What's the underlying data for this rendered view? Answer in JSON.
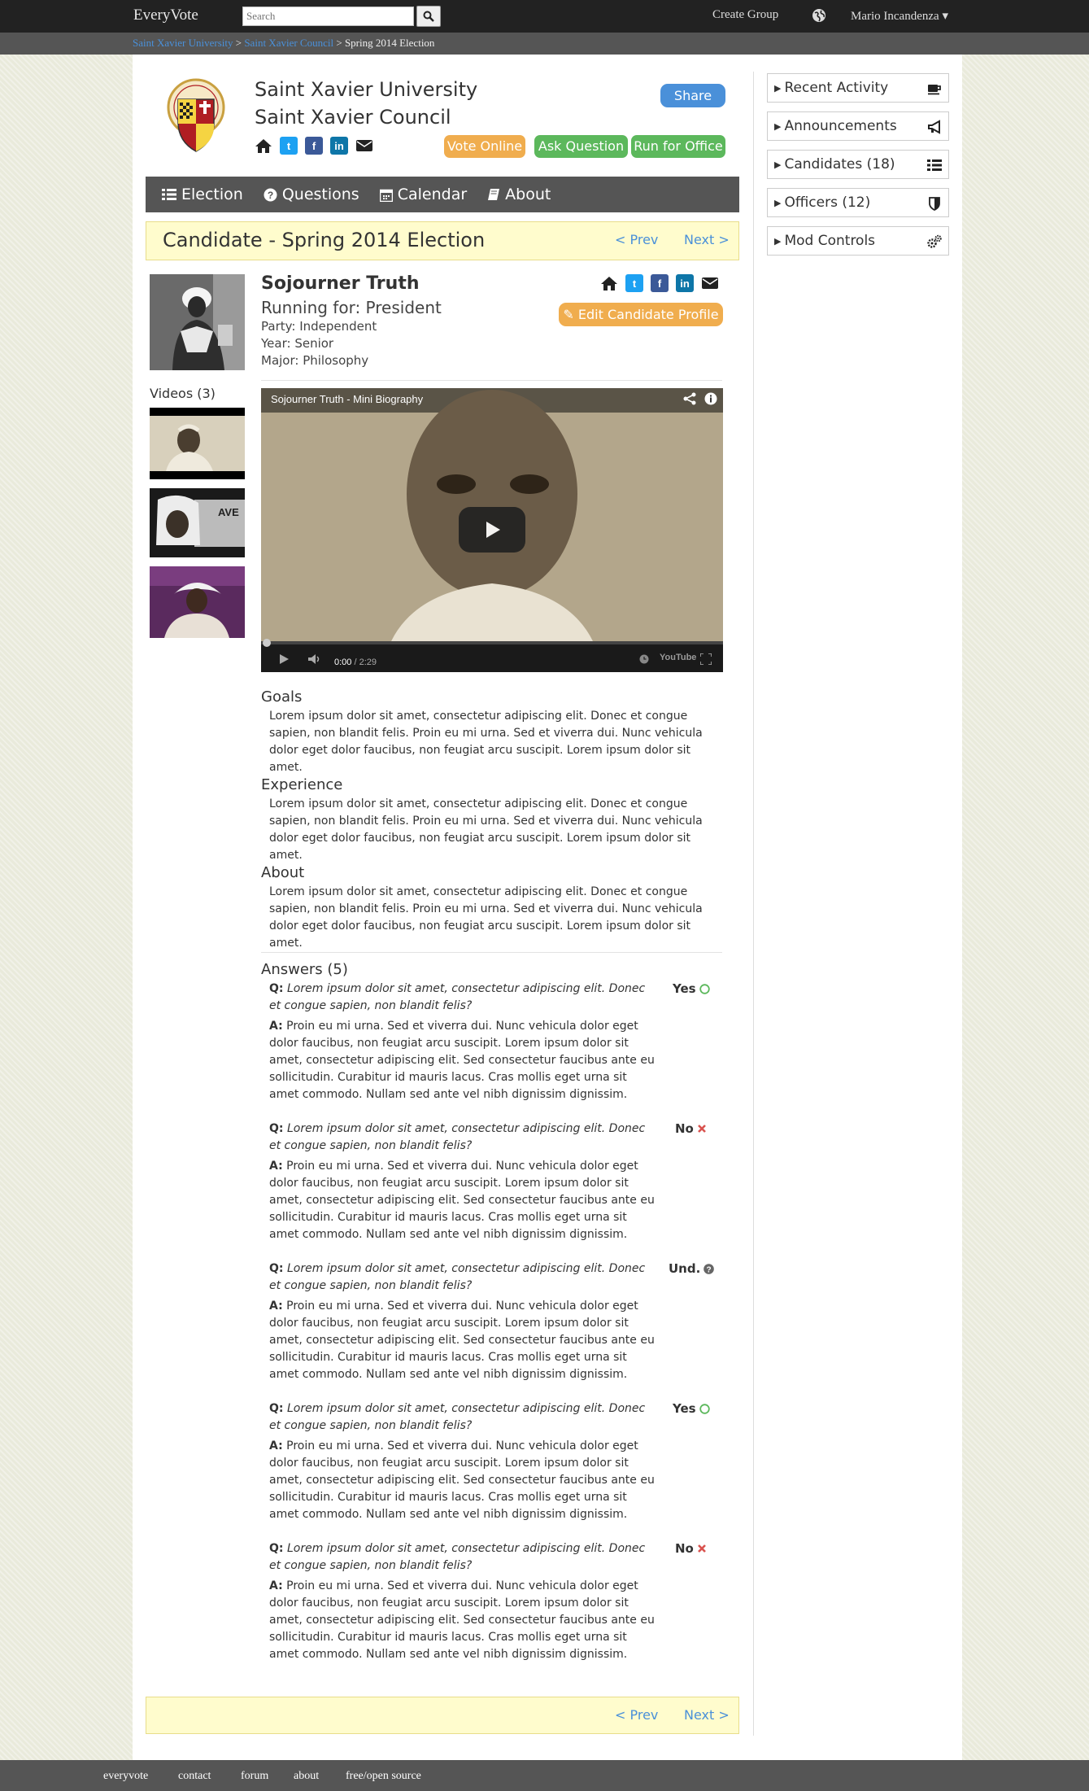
{
  "topbar": {
    "brand": "EveryVote",
    "search_placeholder": "Search",
    "create_group": "Create Group",
    "user": "Mario Incandenza ▾"
  },
  "breadcrumb": {
    "item1": "Saint Xavier University",
    "sep": " > ",
    "item2": "Saint Xavier Council",
    "item3": "Spring 2014 Election"
  },
  "group": {
    "university": "Saint Xavier University",
    "council": "Saint Xavier Council",
    "share": "Share",
    "vote_online": "Vote Online",
    "ask_question": "Ask Question",
    "run_for_office": "Run for Office"
  },
  "nav": {
    "election": "Election",
    "questions": "Questions",
    "calendar": "Calendar",
    "about": "About"
  },
  "title_bar": {
    "title": "Candidate - Spring 2014 Election",
    "prev": "< Prev",
    "next": "Next >"
  },
  "candidate": {
    "name": "Sojourner Truth",
    "running_for": "Running for: President",
    "party": "Party: Independent",
    "year": "Year: Senior",
    "major": "Major: Philosophy",
    "edit_profile": "Edit Candidate Profile",
    "videos_label": "Videos (3)"
  },
  "video": {
    "title": "Sojourner Truth - Mini Biography",
    "time_current": "0:00",
    "time_total": " / 2:29",
    "youtube": "YouTube"
  },
  "sections": {
    "goals_heading": "Goals",
    "goals_text": "Lorem ipsum dolor sit amet, consectetur adipiscing elit. Donec et congue sapien, non blandit felis. Proin eu mi urna. Sed et viverra dui. Nunc vehicula dolor eget dolor faucibus, non feugiat arcu suscipit. Lorem ipsum dolor sit amet.",
    "experience_heading": "Experience",
    "experience_text": "Lorem ipsum dolor sit amet, consectetur adipiscing elit. Donec et congue sapien, non blandit felis. Proin eu mi urna. Sed et viverra dui. Nunc vehicula dolor eget dolor faucibus, non feugiat arcu suscipit. Lorem ipsum dolor sit amet.",
    "about_heading": "About",
    "about_text": "Lorem ipsum dolor sit amet, consectetur adipiscing elit. Donec et congue sapien, non blandit felis. Proin eu mi urna. Sed et viverra dui. Nunc vehicula dolor eget dolor faucibus, non feugiat arcu suscipit. Lorem ipsum dolor sit amet."
  },
  "answers": {
    "heading": "Answers (5)",
    "q_prefix": "Q:",
    "a_prefix": "A:",
    "items": [
      {
        "question": "Lorem ipsum dolor sit amet, consectetur adipiscing elit. Donec et congue sapien, non blandit felis?",
        "answer": "Proin eu mi urna. Sed et viverra dui. Nunc vehicula dolor eget dolor faucibus, non feugiat arcu suscipit. Lorem ipsum dolor sit amet, consectetur adipiscing elit. Sed consectetur faucibus ante eu sollicitudin. Curabitur id mauris lacus. Cras mollis eget urna sit amet commodo. Nullam sed ante vel nibh dignissim dignissim.",
        "stance": "Yes"
      },
      {
        "question": "Lorem ipsum dolor sit amet, consectetur adipiscing elit. Donec et congue sapien, non blandit felis?",
        "answer": "Proin eu mi urna. Sed et viverra dui. Nunc vehicula dolor eget dolor faucibus, non feugiat arcu suscipit. Lorem ipsum dolor sit amet, consectetur adipiscing elit. Sed consectetur faucibus ante eu sollicitudin. Curabitur id mauris lacus. Cras mollis eget urna sit amet commodo. Nullam sed ante vel nibh dignissim dignissim.",
        "stance": "No"
      },
      {
        "question": "Lorem ipsum dolor sit amet, consectetur adipiscing elit. Donec et congue sapien, non blandit felis?",
        "answer": "Proin eu mi urna. Sed et viverra dui. Nunc vehicula dolor eget dolor faucibus, non feugiat arcu suscipit. Lorem ipsum dolor sit amet, consectetur adipiscing elit. Sed consectetur faucibus ante eu sollicitudin. Curabitur id mauris lacus. Cras mollis eget urna sit amet commodo. Nullam sed ante vel nibh dignissim dignissim.",
        "stance": "Und."
      },
      {
        "question": "Lorem ipsum dolor sit amet, consectetur adipiscing elit. Donec et congue sapien, non blandit felis?",
        "answer": "Proin eu mi urna. Sed et viverra dui. Nunc vehicula dolor eget dolor faucibus, non feugiat arcu suscipit. Lorem ipsum dolor sit amet, consectetur adipiscing elit. Sed consectetur faucibus ante eu sollicitudin. Curabitur id mauris lacus. Cras mollis eget urna sit amet commodo. Nullam sed ante vel nibh dignissim dignissim.",
        "stance": "Yes"
      },
      {
        "question": "Lorem ipsum dolor sit amet, consectetur adipiscing elit. Donec et congue sapien, non blandit felis?",
        "answer": "Proin eu mi urna. Sed et viverra dui. Nunc vehicula dolor eget dolor faucibus, non feugiat arcu suscipit. Lorem ipsum dolor sit amet, consectetur adipiscing elit. Sed consectetur faucibus ante eu sollicitudin. Curabitur id mauris lacus. Cras mollis eget urna sit amet commodo. Nullam sed ante vel nibh dignissim dignissim.",
        "stance": "No"
      }
    ]
  },
  "sidebar": {
    "recent_activity": "Recent Activity",
    "announcements": "Announcements",
    "candidates": "Candidates (18)",
    "officers": "Officers (12)",
    "mod_controls": "Mod Controls"
  },
  "footer": {
    "everyvote": "everyvote",
    "contact": "contact",
    "forum": "forum",
    "about": "about",
    "source": "free/open source"
  },
  "colors": {
    "primary": "#4a90d9",
    "warning": "#f0ad4e",
    "success": "#5cb85c",
    "navbar": "#222222",
    "subbar": "#555555",
    "highlight": "#fffccd",
    "twitter": "#1da1f2",
    "facebook": "#3b5998",
    "linkedin": "#0e76a8"
  },
  "icons": [
    "search-icon",
    "globe-icon",
    "home-icon",
    "twitter-icon",
    "facebook-icon",
    "linkedin-icon",
    "envelope-icon",
    "list-icon",
    "question-icon",
    "calendar-icon",
    "book-icon",
    "edit-icon",
    "play-icon",
    "share-icon",
    "info-icon",
    "coffee-icon",
    "bullhorn-icon",
    "shield-icon",
    "cogs-icon",
    "check-circle-icon",
    "x-icon",
    "question-circle-icon"
  ]
}
